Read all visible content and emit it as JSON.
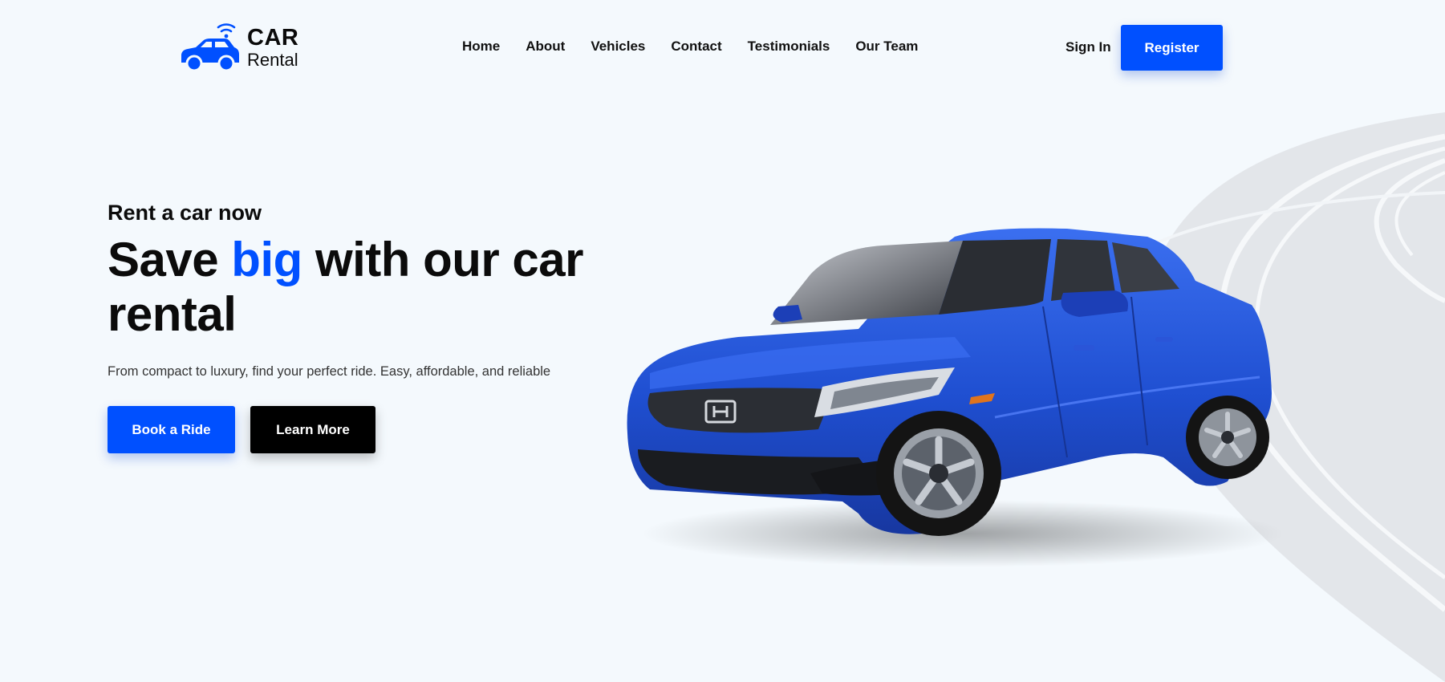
{
  "brand": {
    "title": "CAR",
    "subtitle": "Rental"
  },
  "nav": {
    "items": [
      {
        "label": "Home"
      },
      {
        "label": "About"
      },
      {
        "label": "Vehicles"
      },
      {
        "label": "Contact"
      },
      {
        "label": "Testimonials"
      },
      {
        "label": "Our Team"
      }
    ],
    "sign_in": "Sign In",
    "register": "Register"
  },
  "hero": {
    "eyebrow": "Rent a car now",
    "headline_before": "Save ",
    "headline_accent": "big",
    "headline_after": " with our car rental",
    "description": "From compact to luxury, find your perfect ride. Easy, affordable, and reliable",
    "primary_cta": "Book a Ride",
    "secondary_cta": "Learn More"
  },
  "colors": {
    "accent": "#0050ff",
    "background": "#f4f9fd",
    "car_body": "#1f4fd1",
    "road": "#e3e6ea",
    "dark_button": "#000000"
  },
  "icons": {
    "logo": "connected-car-icon"
  }
}
